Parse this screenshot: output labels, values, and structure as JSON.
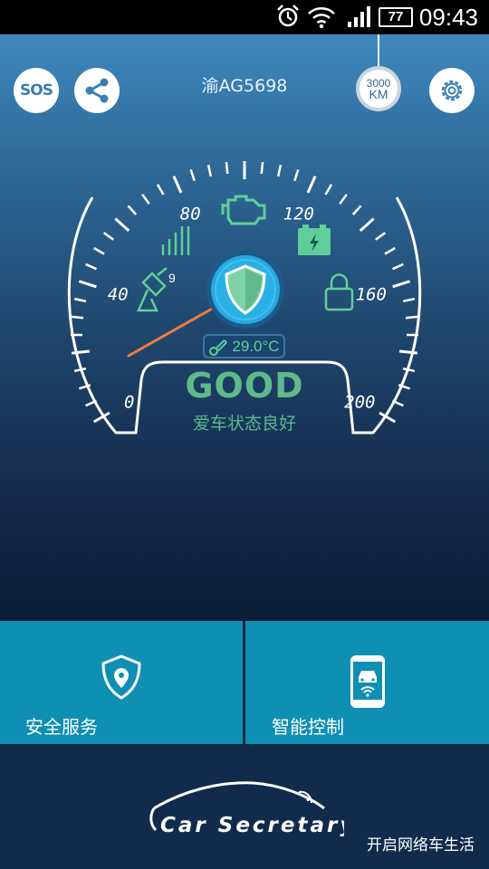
{
  "status_bar": {
    "battery_level": "77",
    "time": "09:43",
    "icons": [
      "alarm-clock-icon",
      "wifi-icon",
      "signal-icon",
      "battery-icon"
    ]
  },
  "header": {
    "sos_label": "SOS",
    "plate": "渝AG5698",
    "mileage_value": "3000",
    "mileage_unit": "KM",
    "icons": [
      "share-icon",
      "settings-gear-icon"
    ]
  },
  "gauge": {
    "speed_labels": [
      "0",
      "40",
      "80",
      "120",
      "160",
      "200"
    ],
    "needle_speed": 0,
    "satellite_count": "9",
    "temperature": "29.0°C",
    "status_title": "GOOD",
    "status_subtitle": "爱车状态良好",
    "indicator_icons": [
      "engine-icon",
      "battery-charge-icon",
      "signal-bars-icon",
      "satellite-dish-icon",
      "lock-icon",
      "shield-icon"
    ],
    "colors": {
      "ok_green": "#5fb98b",
      "needle": "#f07a42",
      "shield_bg": "#29a9de"
    }
  },
  "tiles": [
    {
      "label": "安全服务",
      "icon": "map-pin-shield-icon"
    },
    {
      "label": "智能控制",
      "icon": "phone-car-icon"
    }
  ],
  "footer": {
    "logo_text": "Car Secretary",
    "slogan": "开启网络车生活"
  },
  "colors": {
    "tile_blue": "#0f8fb3",
    "footer_navy": "#102b4c"
  }
}
